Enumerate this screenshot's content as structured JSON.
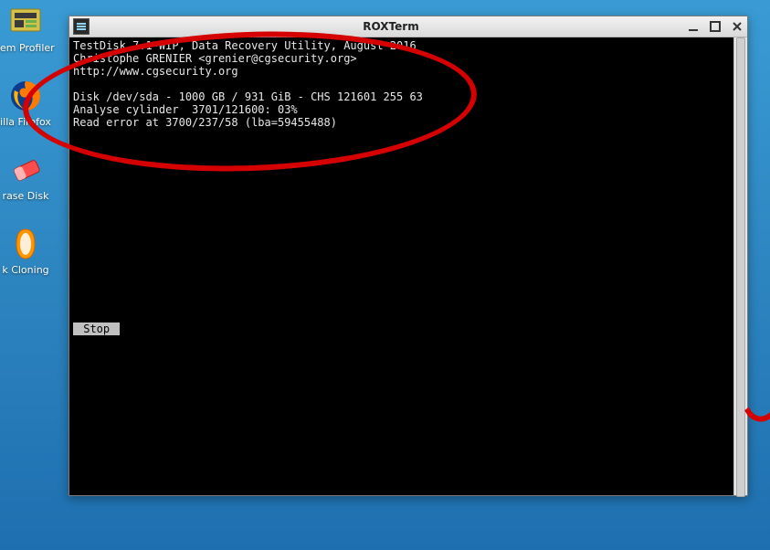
{
  "desktop": {
    "items": [
      {
        "label": "em Profiler"
      },
      {
        "label": "illa Firefox"
      },
      {
        "label": "rase Disk"
      },
      {
        "label": "k Cloning"
      }
    ]
  },
  "window": {
    "title": "ROXTerm"
  },
  "terminal": {
    "line1": "TestDisk 7.1-WIP, Data Recovery Utility, August 2016",
    "line2": "Christophe GRENIER <grenier@cgsecurity.org>",
    "line3": "http://www.cgsecurity.org",
    "blank1": "",
    "line4": "Disk /dev/sda - 1000 GB / 931 GiB - CHS 121601 255 63",
    "line5": "Analyse cylinder  3701/121600: 03%",
    "line6": "Read error at 3700/237/58 (lba=59455488)",
    "stop_label": " Stop "
  }
}
